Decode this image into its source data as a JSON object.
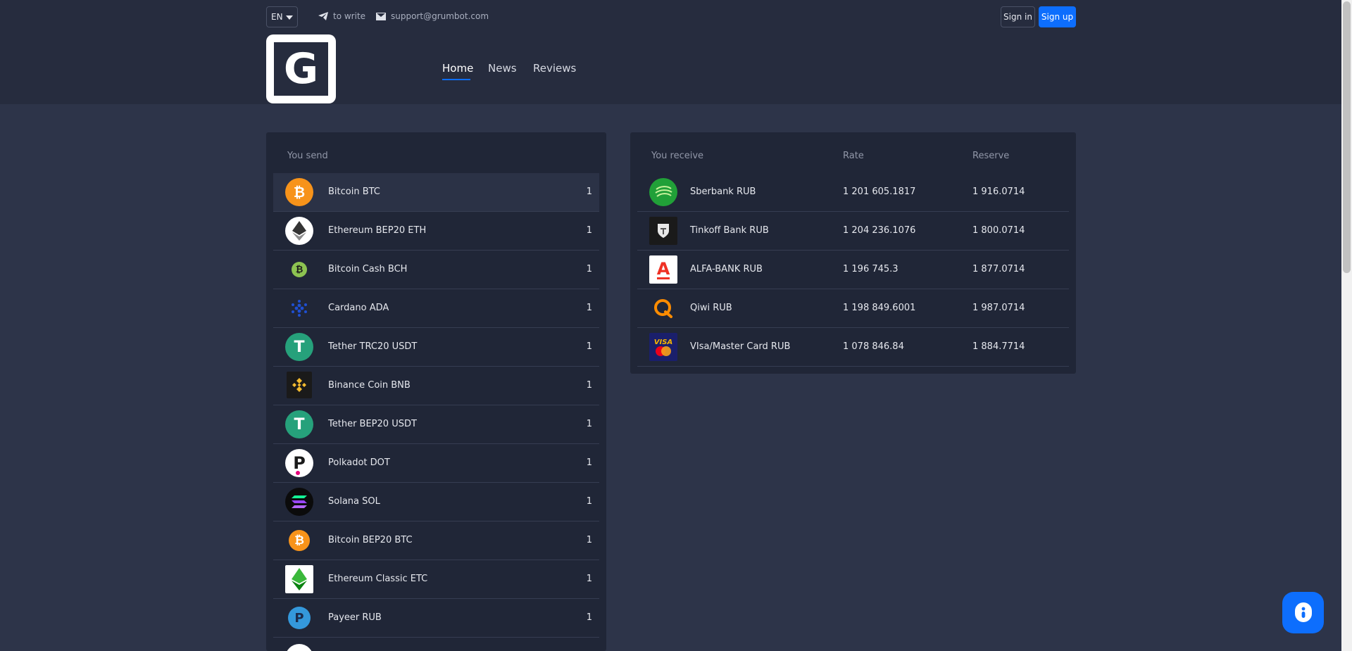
{
  "topbar": {
    "language": "EN",
    "write_label": "to write",
    "email": "support@grumbot.com",
    "signin_label": "Sign in",
    "signup_label": "Sign up"
  },
  "logo": {
    "letter": "G"
  },
  "nav": {
    "items": [
      {
        "label": "Home",
        "active": true
      },
      {
        "label": "News",
        "active": false
      },
      {
        "label": "Reviews",
        "active": false
      }
    ]
  },
  "send": {
    "header": "You send",
    "rows": [
      {
        "name": "Bitcoin BTC",
        "value": "1",
        "icon": "bitcoin-icon",
        "color": "#f7931a"
      },
      {
        "name": "Ethereum BEP20 ETH",
        "value": "1",
        "icon": "ethereum-icon",
        "color": "#ffffff"
      },
      {
        "name": "Bitcoin Cash BCH",
        "value": "1",
        "icon": "bitcoin-cash-icon",
        "color": "#8dc351"
      },
      {
        "name": "Cardano ADA",
        "value": "1",
        "icon": "cardano-icon",
        "color": "#0033ad"
      },
      {
        "name": "Tether TRC20 USDT",
        "value": "1",
        "icon": "tether-icon",
        "color": "#26a17b"
      },
      {
        "name": "Binance Coin BNB",
        "value": "1",
        "icon": "binance-icon",
        "color": "#f3ba2f"
      },
      {
        "name": "Tether BEP20 USDT",
        "value": "1",
        "icon": "tether-icon",
        "color": "#26a17b"
      },
      {
        "name": "Polkadot DOT",
        "value": "1",
        "icon": "polkadot-icon",
        "color": "#e6007a"
      },
      {
        "name": "Solana SOL",
        "value": "1",
        "icon": "solana-icon",
        "color": "#9945ff"
      },
      {
        "name": "Bitcoin BEP20 BTC",
        "value": "1",
        "icon": "bitcoin-icon",
        "color": "#f7931a"
      },
      {
        "name": "Ethereum Classic ETC",
        "value": "1",
        "icon": "ethereum-classic-icon",
        "color": "#3ab83a"
      },
      {
        "name": "Payeer RUB",
        "value": "1",
        "icon": "payeer-icon",
        "color": "#3498db"
      }
    ]
  },
  "receive": {
    "header_receive": "You receive",
    "header_rate": "Rate",
    "header_reserve": "Reserve",
    "rows": [
      {
        "name": "Sberbank RUB",
        "rate": "1 201 605.1817",
        "reserve": "1 916.0714",
        "icon": "sberbank-icon"
      },
      {
        "name": "Tinkoff Bank RUB",
        "rate": "1 204 236.1076",
        "reserve": "1 800.0714",
        "icon": "tinkoff-icon"
      },
      {
        "name": "ALFA-BANK RUB",
        "rate": "1 196 745.3",
        "reserve": "1 877.0714",
        "icon": "alfa-bank-icon"
      },
      {
        "name": "Qiwi RUB",
        "rate": "1 198 849.6001",
        "reserve": "1 987.0714",
        "icon": "qiwi-icon"
      },
      {
        "name": "VIsa/Master Card RUB",
        "rate": "1 078 846.84",
        "reserve": "1 884.7714",
        "icon": "visa-mastercard-icon"
      }
    ]
  },
  "colors": {
    "accent": "#0d6efd",
    "background": "#2d3449",
    "panel": "#202637"
  }
}
